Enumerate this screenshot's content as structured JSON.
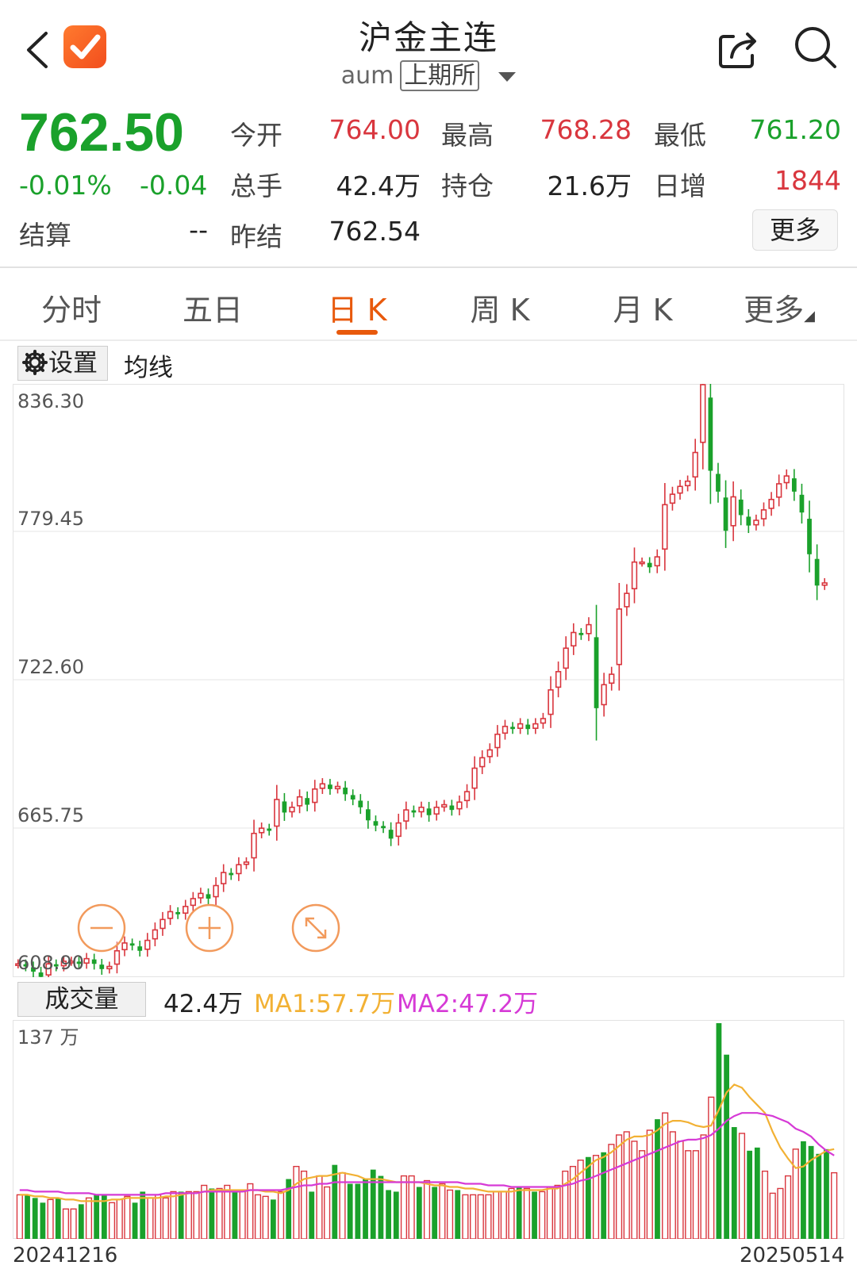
{
  "header": {
    "title": "沪金主连",
    "symbol": "aum",
    "exchange": "上期所"
  },
  "quote": {
    "price": "762.50",
    "change_pct": "-0.01%",
    "change_val": "-0.04",
    "stats": [
      {
        "label": "今开",
        "value": "764.00",
        "color": "red"
      },
      {
        "label": "最高",
        "value": "768.28",
        "color": "red"
      },
      {
        "label": "最低",
        "value": "761.20",
        "color": "green"
      },
      {
        "label": "总手",
        "value": "42.4万",
        "color": "blk"
      },
      {
        "label": "持仓",
        "value": "21.6万",
        "color": "blk"
      },
      {
        "label": "日增",
        "value": "1844",
        "color": "red"
      },
      {
        "label": "结算",
        "value": "--",
        "color": "blk"
      },
      {
        "label": "昨结",
        "value": "762.54",
        "color": "blk"
      }
    ],
    "more_label": "更多"
  },
  "tabs": [
    {
      "label": "分时"
    },
    {
      "label": "五日"
    },
    {
      "label": "日 K",
      "active": true
    },
    {
      "label": "周 K"
    },
    {
      "label": "月 K"
    },
    {
      "label": "更多"
    }
  ],
  "toolbar": {
    "settings_label": "设置",
    "ma_label": "均线"
  },
  "volume": {
    "label": "成交量",
    "current": "42.4万",
    "ma1": "MA1:57.7万",
    "ma2": "MA2:47.2万",
    "axis_max": "137 万"
  },
  "colors": {
    "up": "#d9363e",
    "down": "#1aa12b",
    "accent": "#e8590c",
    "ma1": "#f2b134",
    "ma2": "#d63ad6"
  },
  "chart_data": {
    "type": "candlestick",
    "y_ticks": [
      "836.30",
      "779.45",
      "722.60",
      "665.75",
      "608.90"
    ],
    "ylim": [
      608.9,
      836.3
    ],
    "x_start_label": "20241216",
    "x_end_label": "20250514",
    "close": [
      614,
      613,
      611,
      609,
      614,
      613,
      615,
      615,
      614,
      616,
      614,
      612,
      613,
      619,
      622,
      621,
      619,
      623,
      627,
      631,
      634,
      633,
      636,
      639,
      641,
      639,
      644,
      649,
      648,
      652,
      653,
      664,
      666,
      665,
      677,
      672,
      674,
      678,
      675,
      681,
      683,
      681,
      682,
      679,
      677,
      674,
      669,
      667,
      666,
      662,
      668,
      673,
      672,
      674,
      671,
      674,
      675,
      673,
      676,
      680,
      689,
      693,
      696,
      702,
      705,
      704,
      706,
      704,
      706,
      708,
      719,
      726,
      735,
      741,
      740,
      744,
      712,
      721,
      725,
      750,
      756,
      768,
      768,
      766,
      770,
      790,
      794,
      797,
      799,
      810,
      836,
      803,
      795,
      780,
      793,
      786,
      782,
      784,
      788,
      792,
      798,
      801,
      795,
      787,
      771,
      759,
      760
    ],
    "volume_wan": [
      28,
      28,
      26,
      23,
      25,
      26,
      19,
      19,
      22,
      26,
      28,
      28,
      23,
      25,
      27,
      23,
      30,
      26,
      28,
      26,
      30,
      30,
      30,
      30,
      34,
      32,
      32,
      34,
      30,
      30,
      35,
      28,
      27,
      25,
      30,
      38,
      46,
      43,
      30,
      40,
      33,
      47,
      42,
      35,
      35,
      38,
      44,
      40,
      31,
      30,
      40,
      40,
      33,
      37,
      33,
      35,
      31,
      31,
      28,
      28,
      28,
      28,
      30,
      30,
      32,
      33,
      32,
      30,
      30,
      33,
      34,
      43,
      46,
      50,
      52,
      53,
      55,
      60,
      66,
      68,
      62,
      56,
      69,
      76,
      80,
      68,
      62,
      56,
      56,
      66,
      90,
      137,
      117,
      71,
      67,
      56,
      58,
      43,
      29,
      32,
      40,
      57,
      62,
      59,
      54,
      57,
      42
    ],
    "ma1_wan": [
      28,
      28,
      27,
      27,
      26,
      26,
      25,
      25,
      24,
      24,
      24,
      24,
      25,
      25,
      26,
      26,
      26,
      26,
      26,
      27,
      27,
      28,
      29,
      29,
      30,
      31,
      31,
      31,
      31,
      31,
      31,
      31,
      30,
      30,
      29,
      31,
      35,
      38,
      39,
      40,
      40,
      41,
      42,
      41,
      40,
      38,
      38,
      38,
      37,
      36,
      36,
      36,
      36,
      35,
      34,
      34,
      33,
      33,
      32,
      32,
      31,
      30,
      30,
      30,
      30,
      31,
      31,
      31,
      31,
      32,
      32,
      35,
      38,
      42,
      46,
      50,
      52,
      55,
      59,
      63,
      65,
      65,
      66,
      69,
      73,
      75,
      75,
      74,
      72,
      71,
      72,
      82,
      93,
      98,
      96,
      90,
      85,
      80,
      68,
      58,
      51,
      45,
      46,
      50,
      53,
      56,
      57
    ],
    "ma2_wan": [
      31,
      31,
      30,
      30,
      30,
      30,
      29,
      29,
      29,
      29,
      28,
      28,
      28,
      28,
      28,
      28,
      28,
      28,
      28,
      29,
      29,
      29,
      29,
      29,
      30,
      30,
      30,
      30,
      30,
      30,
      31,
      31,
      31,
      31,
      31,
      32,
      33,
      34,
      34,
      35,
      35,
      36,
      36,
      36,
      36,
      36,
      36,
      36,
      36,
      36,
      36,
      36,
      36,
      36,
      36,
      36,
      36,
      36,
      35,
      35,
      35,
      34,
      34,
      34,
      33,
      33,
      33,
      33,
      33,
      33,
      33,
      34,
      35,
      37,
      38,
      40,
      42,
      44,
      46,
      48,
      50,
      52,
      54,
      56,
      58,
      60,
      62,
      63,
      63,
      64,
      66,
      70,
      75,
      78,
      80,
      80,
      80,
      79,
      78,
      76,
      74,
      70,
      68,
      65,
      60,
      56,
      53
    ]
  }
}
